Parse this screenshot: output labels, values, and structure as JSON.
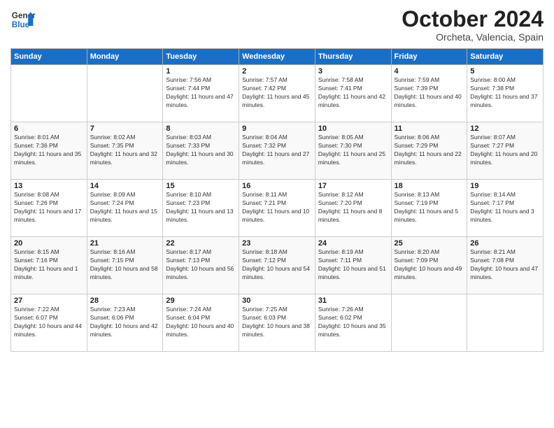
{
  "logo": {
    "line1": "General",
    "line2": "Blue"
  },
  "title": "October 2024",
  "location": "Orcheta, Valencia, Spain",
  "days_of_week": [
    "Sunday",
    "Monday",
    "Tuesday",
    "Wednesday",
    "Thursday",
    "Friday",
    "Saturday"
  ],
  "weeks": [
    [
      {
        "day": "",
        "info": ""
      },
      {
        "day": "",
        "info": ""
      },
      {
        "day": "1",
        "info": "Sunrise: 7:56 AM\nSunset: 7:44 PM\nDaylight: 11 hours and 47 minutes."
      },
      {
        "day": "2",
        "info": "Sunrise: 7:57 AM\nSunset: 7:42 PM\nDaylight: 11 hours and 45 minutes."
      },
      {
        "day": "3",
        "info": "Sunrise: 7:58 AM\nSunset: 7:41 PM\nDaylight: 11 hours and 42 minutes."
      },
      {
        "day": "4",
        "info": "Sunrise: 7:59 AM\nSunset: 7:39 PM\nDaylight: 11 hours and 40 minutes."
      },
      {
        "day": "5",
        "info": "Sunrise: 8:00 AM\nSunset: 7:38 PM\nDaylight: 11 hours and 37 minutes."
      }
    ],
    [
      {
        "day": "6",
        "info": "Sunrise: 8:01 AM\nSunset: 7:36 PM\nDaylight: 11 hours and 35 minutes."
      },
      {
        "day": "7",
        "info": "Sunrise: 8:02 AM\nSunset: 7:35 PM\nDaylight: 11 hours and 32 minutes."
      },
      {
        "day": "8",
        "info": "Sunrise: 8:03 AM\nSunset: 7:33 PM\nDaylight: 11 hours and 30 minutes."
      },
      {
        "day": "9",
        "info": "Sunrise: 8:04 AM\nSunset: 7:32 PM\nDaylight: 11 hours and 27 minutes."
      },
      {
        "day": "10",
        "info": "Sunrise: 8:05 AM\nSunset: 7:30 PM\nDaylight: 11 hours and 25 minutes."
      },
      {
        "day": "11",
        "info": "Sunrise: 8:06 AM\nSunset: 7:29 PM\nDaylight: 11 hours and 22 minutes."
      },
      {
        "day": "12",
        "info": "Sunrise: 8:07 AM\nSunset: 7:27 PM\nDaylight: 11 hours and 20 minutes."
      }
    ],
    [
      {
        "day": "13",
        "info": "Sunrise: 8:08 AM\nSunset: 7:26 PM\nDaylight: 11 hours and 17 minutes."
      },
      {
        "day": "14",
        "info": "Sunrise: 8:09 AM\nSunset: 7:24 PM\nDaylight: 11 hours and 15 minutes."
      },
      {
        "day": "15",
        "info": "Sunrise: 8:10 AM\nSunset: 7:23 PM\nDaylight: 11 hours and 13 minutes."
      },
      {
        "day": "16",
        "info": "Sunrise: 8:11 AM\nSunset: 7:21 PM\nDaylight: 11 hours and 10 minutes."
      },
      {
        "day": "17",
        "info": "Sunrise: 8:12 AM\nSunset: 7:20 PM\nDaylight: 11 hours and 8 minutes."
      },
      {
        "day": "18",
        "info": "Sunrise: 8:13 AM\nSunset: 7:19 PM\nDaylight: 11 hours and 5 minutes."
      },
      {
        "day": "19",
        "info": "Sunrise: 8:14 AM\nSunset: 7:17 PM\nDaylight: 11 hours and 3 minutes."
      }
    ],
    [
      {
        "day": "20",
        "info": "Sunrise: 8:15 AM\nSunset: 7:16 PM\nDaylight: 11 hours and 1 minute."
      },
      {
        "day": "21",
        "info": "Sunrise: 8:16 AM\nSunset: 7:15 PM\nDaylight: 10 hours and 58 minutes."
      },
      {
        "day": "22",
        "info": "Sunrise: 8:17 AM\nSunset: 7:13 PM\nDaylight: 10 hours and 56 minutes."
      },
      {
        "day": "23",
        "info": "Sunrise: 8:18 AM\nSunset: 7:12 PM\nDaylight: 10 hours and 54 minutes."
      },
      {
        "day": "24",
        "info": "Sunrise: 8:19 AM\nSunset: 7:11 PM\nDaylight: 10 hours and 51 minutes."
      },
      {
        "day": "25",
        "info": "Sunrise: 8:20 AM\nSunset: 7:09 PM\nDaylight: 10 hours and 49 minutes."
      },
      {
        "day": "26",
        "info": "Sunrise: 8:21 AM\nSunset: 7:08 PM\nDaylight: 10 hours and 47 minutes."
      }
    ],
    [
      {
        "day": "27",
        "info": "Sunrise: 7:22 AM\nSunset: 6:07 PM\nDaylight: 10 hours and 44 minutes."
      },
      {
        "day": "28",
        "info": "Sunrise: 7:23 AM\nSunset: 6:06 PM\nDaylight: 10 hours and 42 minutes."
      },
      {
        "day": "29",
        "info": "Sunrise: 7:24 AM\nSunset: 6:04 PM\nDaylight: 10 hours and 40 minutes."
      },
      {
        "day": "30",
        "info": "Sunrise: 7:25 AM\nSunset: 6:03 PM\nDaylight: 10 hours and 38 minutes."
      },
      {
        "day": "31",
        "info": "Sunrise: 7:26 AM\nSunset: 6:02 PM\nDaylight: 10 hours and 35 minutes."
      },
      {
        "day": "",
        "info": ""
      },
      {
        "day": "",
        "info": ""
      }
    ]
  ]
}
